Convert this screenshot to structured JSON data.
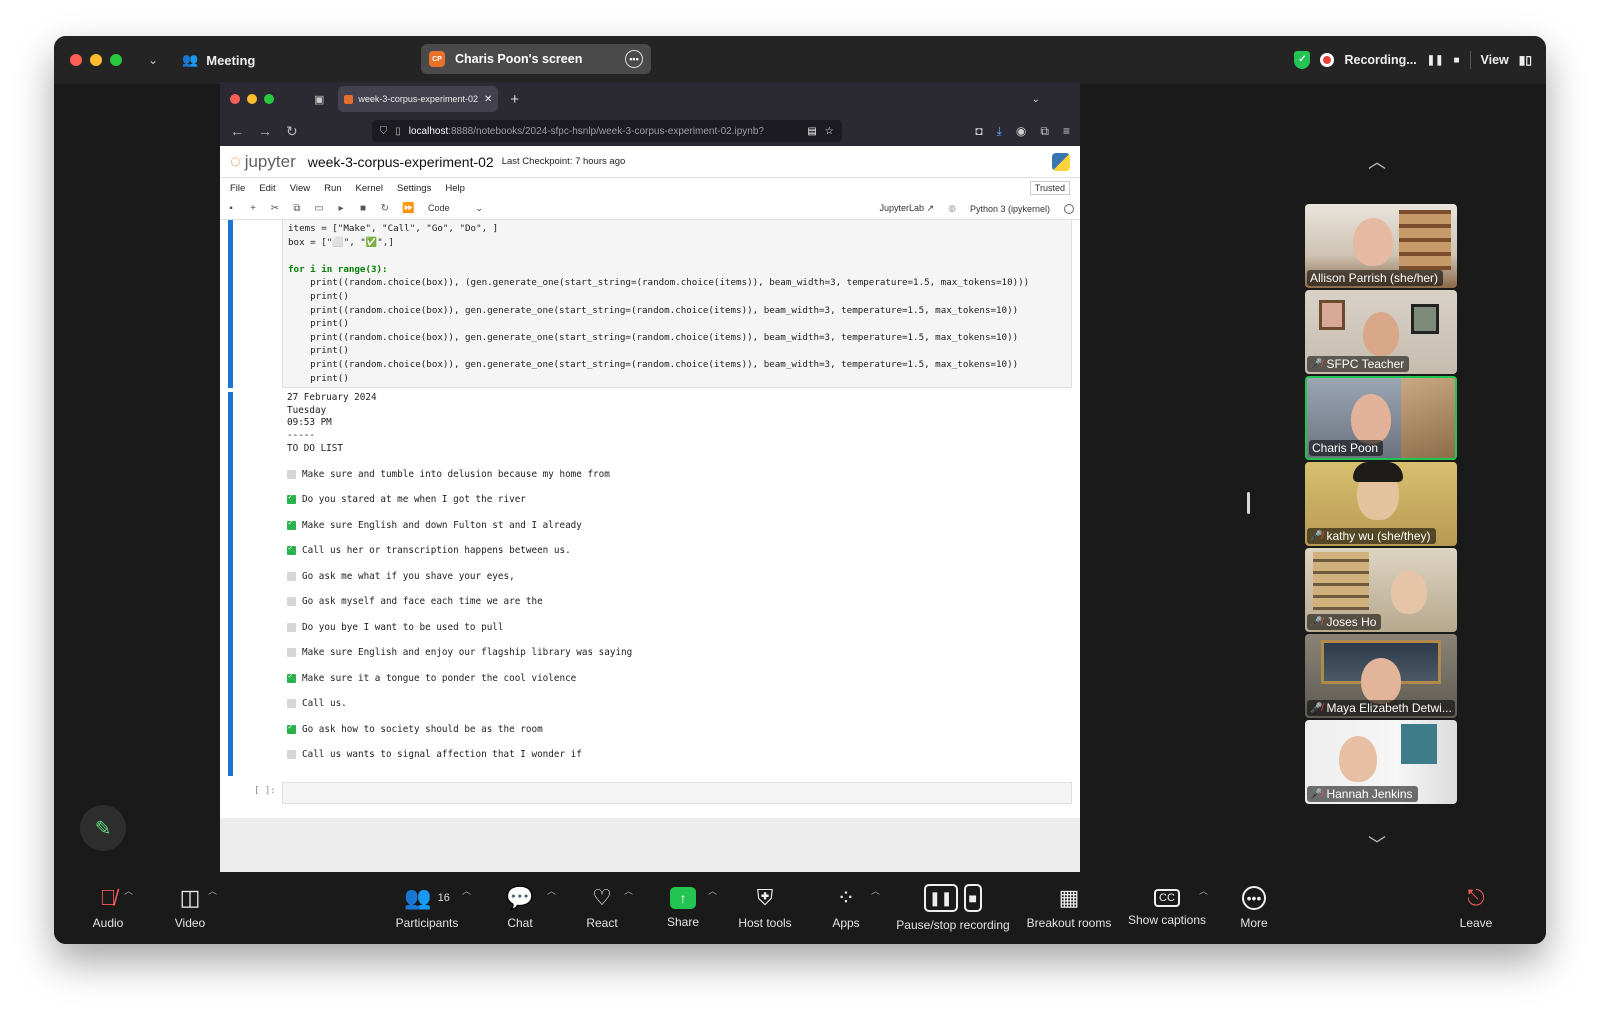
{
  "titlebar": {
    "meeting_label": "Meeting",
    "share_label": "Charis Poon's screen",
    "share_badge": "CP",
    "recording_label": "Recording...",
    "view_label": "View"
  },
  "browser": {
    "tab_title": "week-3-corpus-experiment-02",
    "url_host": "localhost",
    "url_rest": ":8888/notebooks/2024-sfpc-hsnlp/week-3-corpus-experiment-02.ipynb?"
  },
  "jupyter": {
    "logo_text": "jupyter",
    "notebook_title": "week-3-corpus-experiment-02",
    "checkpoint": "Last Checkpoint: 7 hours ago",
    "menu": [
      "File",
      "Edit",
      "View",
      "Run",
      "Kernel",
      "Settings",
      "Help"
    ],
    "trusted": "Trusted",
    "cell_type": "Code",
    "jupyterlab_link": "JupyterLab",
    "kernel_name": "Python 3 (ipykernel)",
    "empty_prompt": "[ ]:"
  },
  "code": {
    "line1": "items = [\"Make\", \"Call\", \"Go\", \"Do\", ]",
    "line2": "box = [\"⬜\", \"✅\",]",
    "line3": "for i in range(3):",
    "line4": "    print((random.choice(box)), (gen.generate_one(start_string=(random.choice(items)), beam_width=3, temperature=1.5, max_tokens=10)))",
    "line5": "    print()",
    "line6": "    print((random.choice(box)), gen.generate_one(start_string=(random.choice(items)), beam_width=3, temperature=1.5, max_tokens=10))",
    "line7": "    print()",
    "line8": "    print((random.choice(box)), gen.generate_one(start_string=(random.choice(items)), beam_width=3, temperature=1.5, max_tokens=10))",
    "line9": "    print()",
    "line10": "    print((random.choice(box)), gen.generate_one(start_string=(random.choice(items)), beam_width=3, temperature=1.5, max_tokens=10))",
    "line11": "    print()"
  },
  "output": {
    "date": "27 February 2024",
    "weekday": "Tuesday",
    "time": "09:53 PM",
    "rule": "-----",
    "heading": "TO DO LIST",
    "todos": [
      {
        "checked": false,
        "text": "Make sure and tumble into delusion because my home from"
      },
      {
        "checked": true,
        "text": "Do you stared at me when I got the river"
      },
      {
        "checked": true,
        "text": "Make sure English and down Fulton st and I already"
      },
      {
        "checked": true,
        "text": "Call us her or transcription happens between us."
      },
      {
        "checked": false,
        "text": "Go ask me what if you shave your eyes,"
      },
      {
        "checked": false,
        "text": "Go ask myself and face each time we are the"
      },
      {
        "checked": false,
        "text": "Do you bye I want to be used to pull"
      },
      {
        "checked": false,
        "text": "Make sure English and enjoy our flagship library was saying"
      },
      {
        "checked": true,
        "text": "Make sure it a tongue to ponder the cool violence"
      },
      {
        "checked": false,
        "text": "Call us."
      },
      {
        "checked": true,
        "text": "Go ask how to society should be as the room"
      },
      {
        "checked": false,
        "text": "Call us wants to signal affection that I wonder if"
      }
    ]
  },
  "participants": [
    {
      "name": "Allison Parrish (she/her)",
      "muted": false
    },
    {
      "name": "SFPC Teacher",
      "muted": true
    },
    {
      "name": "Charis Poon",
      "muted": false
    },
    {
      "name": "kathy wu (she/they)",
      "muted": true
    },
    {
      "name": "Joses Ho",
      "muted": true
    },
    {
      "name": "Maya Elizabeth Detwi...",
      "muted": true
    },
    {
      "name": "Hannah Jenkins",
      "muted": true
    }
  ],
  "toolbar": {
    "audio": "Audio",
    "video": "Video",
    "participants": "Participants",
    "participants_count": "16",
    "chat": "Chat",
    "react": "React",
    "share": "Share",
    "host_tools": "Host tools",
    "apps": "Apps",
    "pause_stop": "Pause/stop recording",
    "breakout": "Breakout rooms",
    "captions": "Show captions",
    "more": "More",
    "leave": "Leave"
  }
}
